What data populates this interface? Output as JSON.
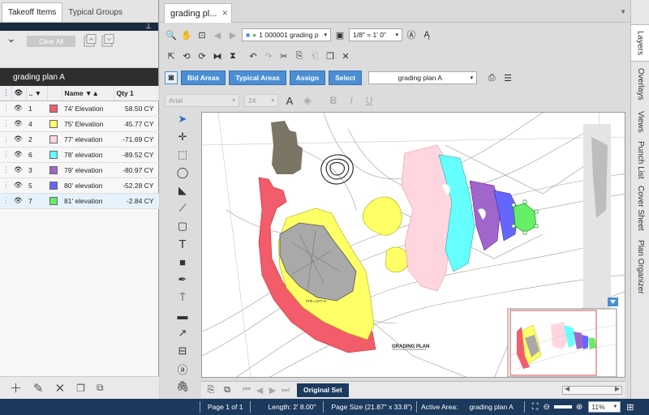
{
  "left_panel": {
    "tabs": [
      "Takeoff Items",
      "Typical Groups"
    ],
    "clear_all": "Clear All",
    "plan_name": "grading plan A",
    "columns": [
      "Name",
      "Qty 1"
    ],
    "rows": [
      {
        "num": "1",
        "color": "#f25c6b",
        "name": "74' Elevation",
        "qty": "58.50 CY"
      },
      {
        "num": "4",
        "color": "#ffff66",
        "name": "75' Elevation",
        "qty": "45.77 CY"
      },
      {
        "num": "2",
        "color": "#ffd6e0",
        "name": "77' elevation",
        "qty": "-71.69 CY"
      },
      {
        "num": "6",
        "color": "#66ffff",
        "name": "78' elevation",
        "qty": "-89.52 CY"
      },
      {
        "num": "3",
        "color": "#a066cc",
        "name": "79' elevation",
        "qty": "-80.97 CY"
      },
      {
        "num": "5",
        "color": "#6666ff",
        "name": "80' elevation",
        "qty": "-52.28 CY"
      },
      {
        "num": "7",
        "color": "#66ee66",
        "name": "81' elevation",
        "qty": "-2.84 CY"
      }
    ]
  },
  "doc": {
    "tab_title": "grading pl...",
    "page_combo": "1   000001 grading p",
    "scale": "1/8\" = 1' 0\"",
    "buttons": [
      "Bid Areas",
      "Typical Areas",
      "Assign",
      "Select"
    ],
    "area_select": "grading plan A",
    "font": "Arial",
    "font_size": "24",
    "plan_label": "GRADING PLAN",
    "ffe_label": "FFE=1377.5",
    "page_set": "Original Set"
  },
  "right_tabs": [
    "Layers",
    "Overlays",
    "Views",
    "Punch List",
    "Cover Sheet",
    "Plan Organizer"
  ],
  "status": {
    "page": "Page 1 of 1",
    "length": "Length: 2' 8.00\"",
    "page_size": "Page Size (21.87\" x 33.8\")",
    "active_area_label": "Active Area:",
    "active_area": "grading plan A",
    "zoom": "11%"
  }
}
